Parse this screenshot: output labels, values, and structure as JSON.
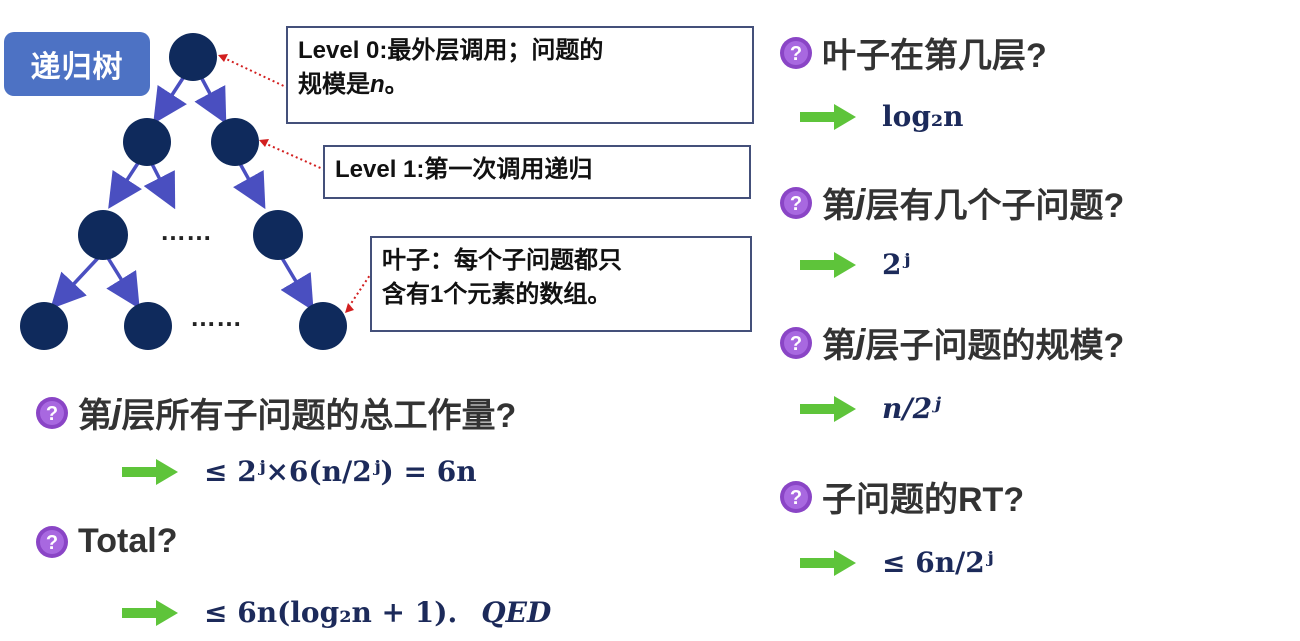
{
  "tree": {
    "badge_label": "递归树",
    "ellipsis_1": "……",
    "ellipsis_2": "……"
  },
  "callouts": {
    "level0": "Level 0:最外层调用；问题的规模是n。",
    "level0_line1": "Level 0:最外层调用；问题的",
    "level0_line2_prefix": "规模是",
    "level0_line2_var": "n",
    "level0_line2_suffix": "。",
    "level1": "Level 1:第一次调用递归",
    "leaf_line1": "叶子：每个子问题都只",
    "leaf_line2": "含有1个元素的数组。"
  },
  "questions": {
    "leaf_level": "叶子在第几层?",
    "count_at_j_prefix": "第",
    "count_at_j_var": "j",
    "count_at_j_suffix": "层有几个子问题?",
    "size_at_j_prefix": "第",
    "size_at_j_var": "j",
    "size_at_j_suffix": "层子问题的规模?",
    "rt": "子问题的RT?",
    "work_at_j_prefix": "第",
    "work_at_j_var": "j",
    "work_at_j_suffix": "层所有子问题的总工作量?",
    "total": "Total?"
  },
  "answers": {
    "leaf_level": "log₂n",
    "count_at_j": "2ʲ",
    "size_at_j": "n/2ʲ",
    "rt": "≤ 6n/2ʲ",
    "work_at_j": "≤ 2ʲ×6(n/2ʲ) = 6n",
    "total": "≤ 6n(log₂n + 1).",
    "qed": "QED"
  },
  "colors": {
    "node": "#0f2a5c",
    "edge": "#4a4fc0",
    "badge": "#4d72c4",
    "arrow": "#5ec43a",
    "pointer": "#d21f1f",
    "question_icon": "#8a45c6"
  },
  "icons": {
    "question": "question-circle-icon",
    "arrow": "green-right-arrow-icon"
  }
}
